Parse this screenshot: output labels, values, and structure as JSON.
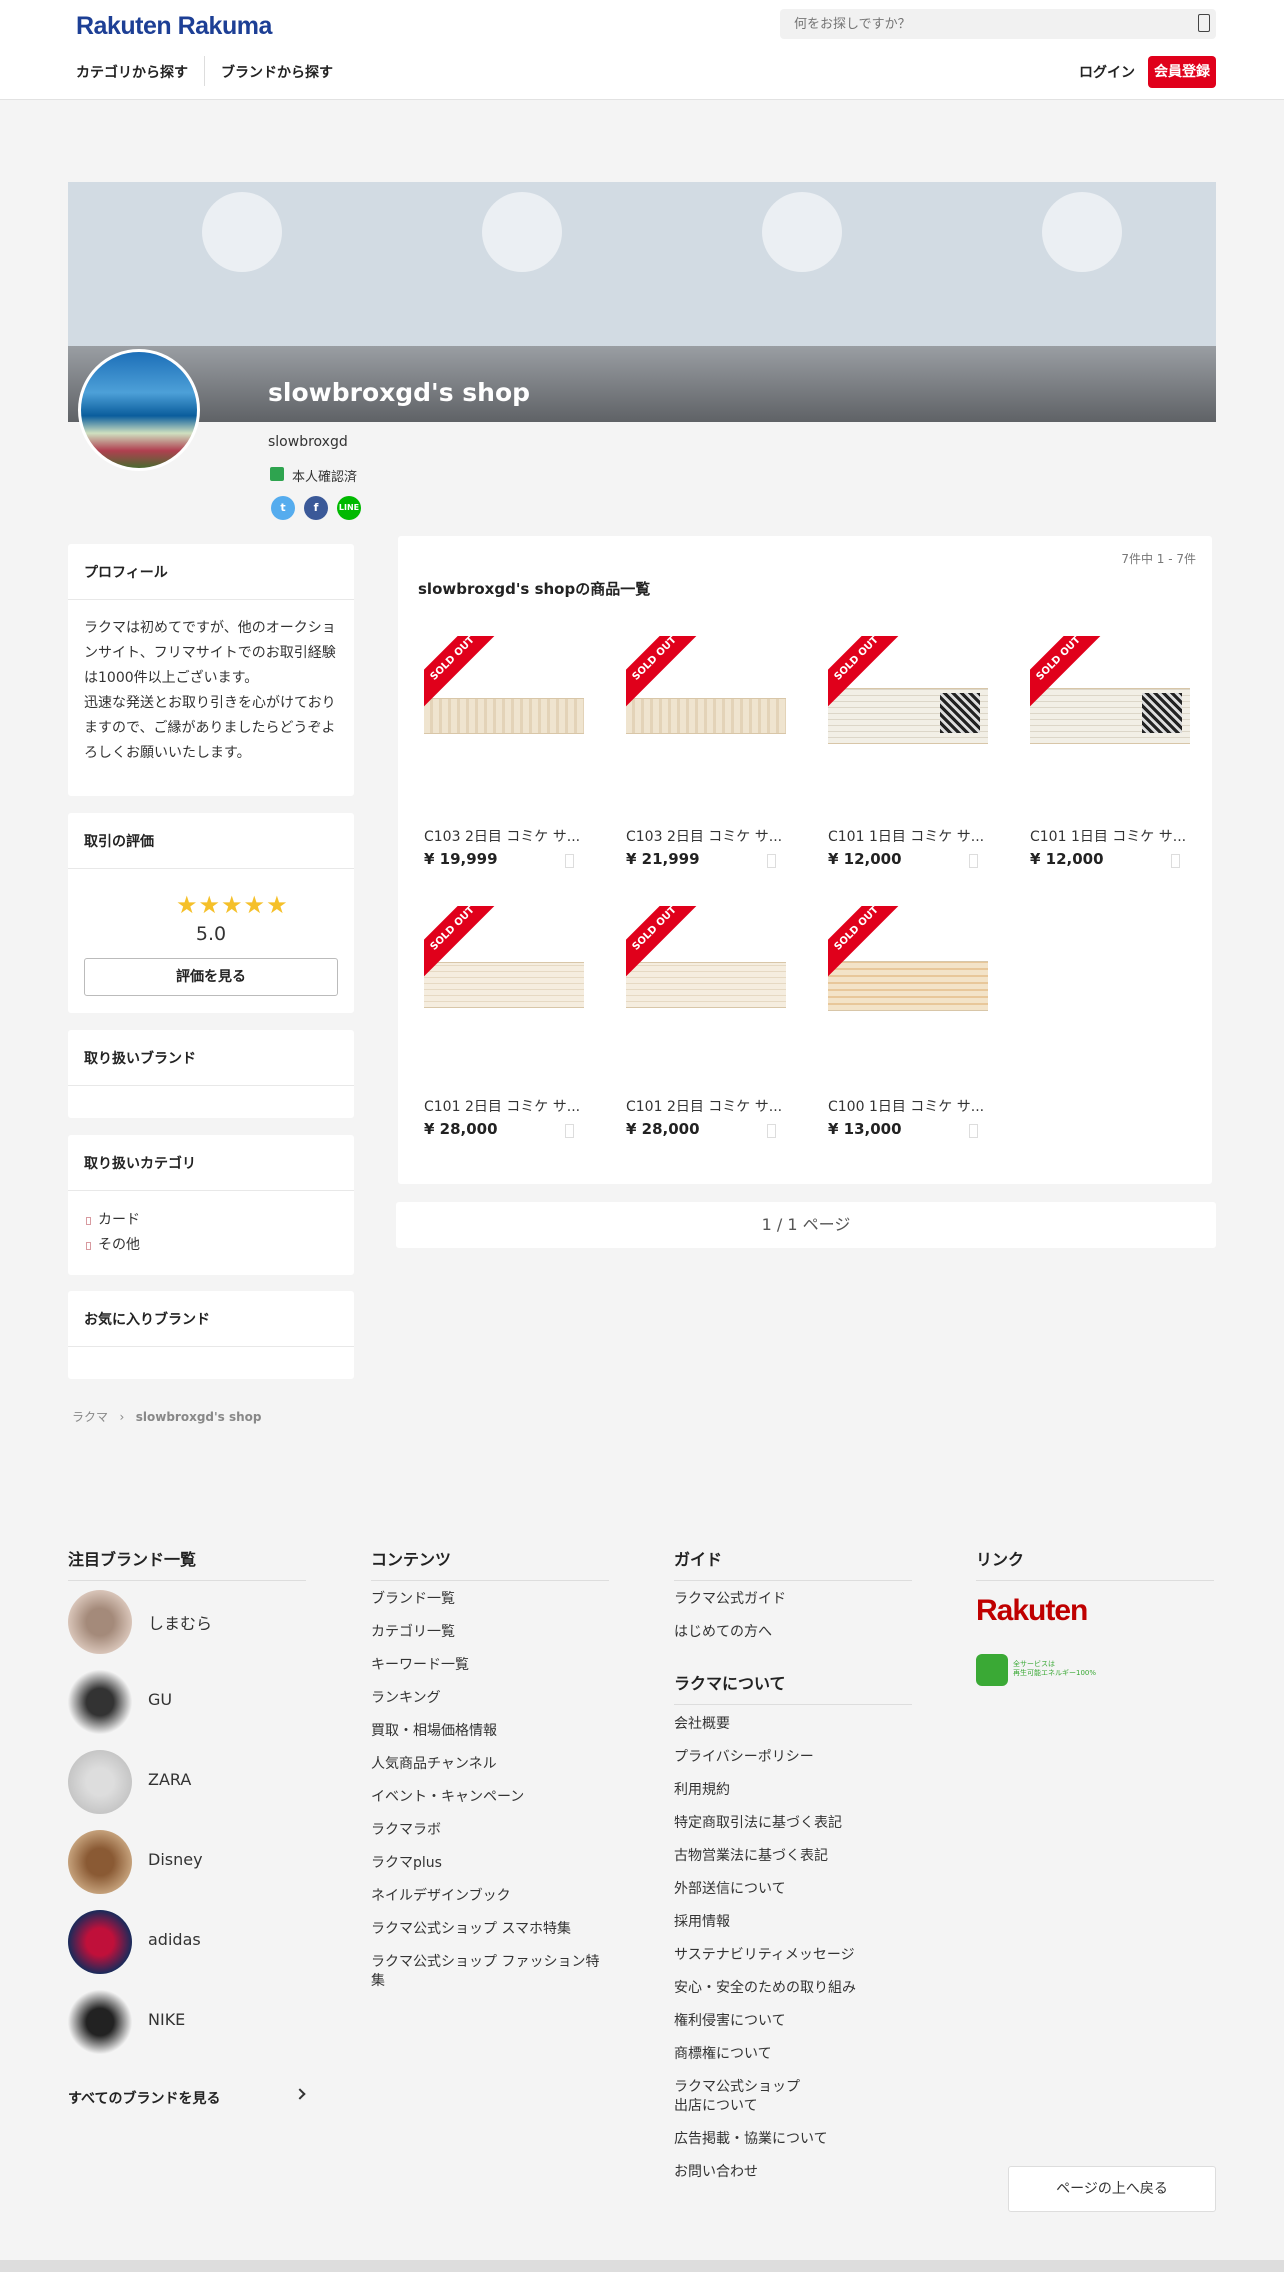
{
  "header": {
    "logo": "Rakuten Rakuma",
    "search_placeholder": "何をお探しですか？",
    "nav": [
      "カテゴリから探す",
      "ブランドから探す"
    ],
    "login": "ログイン",
    "register": "会員登録"
  },
  "shop": {
    "title": "slowbroxgd's shop",
    "username": "slowbroxgd",
    "verified": "本人確認済",
    "social": [
      "Twitter",
      "Facebook",
      "LINE"
    ]
  },
  "sidebar": {
    "profile": {
      "heading": "プロフィール",
      "text": "ラクマは初めてですが、他のオークションサイト、フリマサイトでのお取引経験は1000件以上ございます。\n迅速な発送とお取り引きを心がけておりますので、ご縁がありましたらどうぞよろしくお願いいたします。"
    },
    "rating": {
      "heading": "取引の評価",
      "score": "5.0",
      "button": "評価を見る"
    },
    "brands": {
      "heading": "取り扱いブランド"
    },
    "categories": {
      "heading": "取り扱いカテゴリ",
      "items": [
        "カード",
        "その他"
      ]
    },
    "fav_brands": {
      "heading": "お気に入りブランド"
    }
  },
  "items": {
    "count": "7件中 1 - 7件",
    "title": "slowbroxgd's shopの商品一覧",
    "sold_label": "SOLD OUT",
    "list": [
      {
        "name": "C103 2日目 コミケ サ...",
        "price": "¥ 19,999"
      },
      {
        "name": "C103 2日目 コミケ サ...",
        "price": "¥ 21,999"
      },
      {
        "name": "C101 1日目 コミケ サ...",
        "price": "¥ 12,000"
      },
      {
        "name": "C101 1日目 コミケ サ...",
        "price": "¥ 12,000"
      },
      {
        "name": "C101 2日目 コミケ サ...",
        "price": "¥ 28,000"
      },
      {
        "name": "C101 2日目 コミケ サ...",
        "price": "¥ 28,000"
      },
      {
        "name": "C100 1日目 コミケ サ...",
        "price": "¥ 13,000"
      }
    ]
  },
  "pager": "1 / 1 ページ",
  "breadcrumb": [
    "ラクマ",
    "slowbroxgd's shop"
  ],
  "footer": {
    "brands_heading": "注目ブランド一覧",
    "brands": [
      "しまむら",
      "GU",
      "ZARA",
      "Disney",
      "adidas",
      "NIKE"
    ],
    "all_brands": "すべてのブランドを見る",
    "contents_heading": "コンテンツ",
    "contents": [
      "ブランド一覧",
      "カテゴリ一覧",
      "キーワード一覧",
      "ランキング",
      "買取・相場価格情報",
      "人気商品チャンネル",
      "イベント・キャンペーン",
      "ラクマラボ",
      "ラクマplus",
      "ネイルデザインブック",
      "ラクマ公式ショップ スマホ特集",
      "ラクマ公式ショップ ファッション特集"
    ],
    "guide_heading": "ガイド",
    "guide": [
      "ラクマ公式ガイド",
      "はじめての方へ"
    ],
    "about_heading": "ラクマについて",
    "about": [
      "会社概要",
      "プライバシーポリシー",
      "利用規約",
      "特定商取引法に基づく表記",
      "古物営業法に基づく表記",
      "外部送信について",
      "採用情報",
      "サステナビリティメッセージ",
      "安心・安全のための取り組み",
      "権利侵害について",
      "商標権について",
      "ラクマ公式ショップ\n出店について",
      "広告掲載・協業について",
      "お問い合わせ"
    ],
    "link_heading": "リンク",
    "rakuten_logo": "Rakuten",
    "green_text": "全サービスは\n再生可能エネルギー100%",
    "back_to_top": "ページの上へ戻る"
  }
}
